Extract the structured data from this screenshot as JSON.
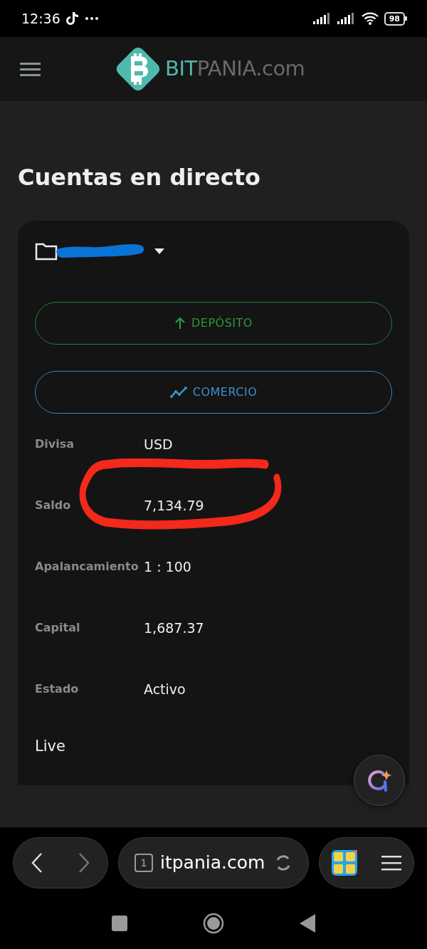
{
  "status_bar": {
    "time": "12:36",
    "battery": "98"
  },
  "header": {
    "logo": {
      "part_1": "BIT",
      "part_2": "PANIA.com"
    }
  },
  "page": {
    "title": "Cuentas en directo"
  },
  "account_card": {
    "buttons": [
      {
        "label": "DEPÓSITO",
        "kind": "deposit"
      },
      {
        "label": "COMERCIO",
        "kind": "trade"
      }
    ],
    "fields": [
      {
        "label": "Divisa",
        "value": "USD"
      },
      {
        "label": "Saldo",
        "value": "7,134.79"
      },
      {
        "label": "Apalancamiento",
        "value": "1 : 100"
      },
      {
        "label": "Capital",
        "value": "1,687.37"
      },
      {
        "label": "Estado",
        "value": "Activo"
      }
    ],
    "footer": "Live"
  },
  "browser_bar": {
    "tab_count": "1",
    "url": "itpania.com"
  }
}
